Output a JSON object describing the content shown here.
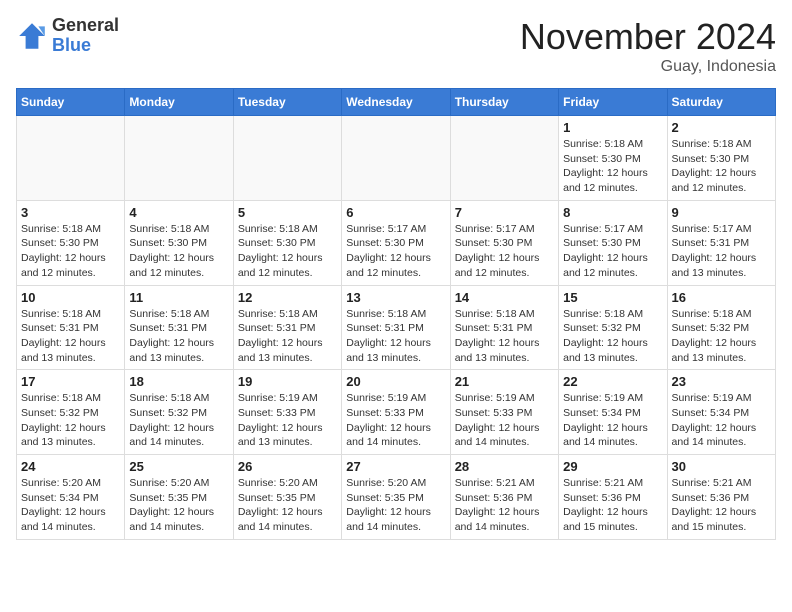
{
  "header": {
    "logo_line1": "General",
    "logo_line2": "Blue",
    "month": "November 2024",
    "location": "Guay, Indonesia"
  },
  "weekdays": [
    "Sunday",
    "Monday",
    "Tuesday",
    "Wednesday",
    "Thursday",
    "Friday",
    "Saturday"
  ],
  "weeks": [
    [
      {
        "day": "",
        "info": ""
      },
      {
        "day": "",
        "info": ""
      },
      {
        "day": "",
        "info": ""
      },
      {
        "day": "",
        "info": ""
      },
      {
        "day": "",
        "info": ""
      },
      {
        "day": "1",
        "info": "Sunrise: 5:18 AM\nSunset: 5:30 PM\nDaylight: 12 hours\nand 12 minutes."
      },
      {
        "day": "2",
        "info": "Sunrise: 5:18 AM\nSunset: 5:30 PM\nDaylight: 12 hours\nand 12 minutes."
      }
    ],
    [
      {
        "day": "3",
        "info": "Sunrise: 5:18 AM\nSunset: 5:30 PM\nDaylight: 12 hours\nand 12 minutes."
      },
      {
        "day": "4",
        "info": "Sunrise: 5:18 AM\nSunset: 5:30 PM\nDaylight: 12 hours\nand 12 minutes."
      },
      {
        "day": "5",
        "info": "Sunrise: 5:18 AM\nSunset: 5:30 PM\nDaylight: 12 hours\nand 12 minutes."
      },
      {
        "day": "6",
        "info": "Sunrise: 5:17 AM\nSunset: 5:30 PM\nDaylight: 12 hours\nand 12 minutes."
      },
      {
        "day": "7",
        "info": "Sunrise: 5:17 AM\nSunset: 5:30 PM\nDaylight: 12 hours\nand 12 minutes."
      },
      {
        "day": "8",
        "info": "Sunrise: 5:17 AM\nSunset: 5:30 PM\nDaylight: 12 hours\nand 12 minutes."
      },
      {
        "day": "9",
        "info": "Sunrise: 5:17 AM\nSunset: 5:31 PM\nDaylight: 12 hours\nand 13 minutes."
      }
    ],
    [
      {
        "day": "10",
        "info": "Sunrise: 5:18 AM\nSunset: 5:31 PM\nDaylight: 12 hours\nand 13 minutes."
      },
      {
        "day": "11",
        "info": "Sunrise: 5:18 AM\nSunset: 5:31 PM\nDaylight: 12 hours\nand 13 minutes."
      },
      {
        "day": "12",
        "info": "Sunrise: 5:18 AM\nSunset: 5:31 PM\nDaylight: 12 hours\nand 13 minutes."
      },
      {
        "day": "13",
        "info": "Sunrise: 5:18 AM\nSunset: 5:31 PM\nDaylight: 12 hours\nand 13 minutes."
      },
      {
        "day": "14",
        "info": "Sunrise: 5:18 AM\nSunset: 5:31 PM\nDaylight: 12 hours\nand 13 minutes."
      },
      {
        "day": "15",
        "info": "Sunrise: 5:18 AM\nSunset: 5:32 PM\nDaylight: 12 hours\nand 13 minutes."
      },
      {
        "day": "16",
        "info": "Sunrise: 5:18 AM\nSunset: 5:32 PM\nDaylight: 12 hours\nand 13 minutes."
      }
    ],
    [
      {
        "day": "17",
        "info": "Sunrise: 5:18 AM\nSunset: 5:32 PM\nDaylight: 12 hours\nand 13 minutes."
      },
      {
        "day": "18",
        "info": "Sunrise: 5:18 AM\nSunset: 5:32 PM\nDaylight: 12 hours\nand 14 minutes."
      },
      {
        "day": "19",
        "info": "Sunrise: 5:19 AM\nSunset: 5:33 PM\nDaylight: 12 hours\nand 13 minutes."
      },
      {
        "day": "20",
        "info": "Sunrise: 5:19 AM\nSunset: 5:33 PM\nDaylight: 12 hours\nand 14 minutes."
      },
      {
        "day": "21",
        "info": "Sunrise: 5:19 AM\nSunset: 5:33 PM\nDaylight: 12 hours\nand 14 minutes."
      },
      {
        "day": "22",
        "info": "Sunrise: 5:19 AM\nSunset: 5:34 PM\nDaylight: 12 hours\nand 14 minutes."
      },
      {
        "day": "23",
        "info": "Sunrise: 5:19 AM\nSunset: 5:34 PM\nDaylight: 12 hours\nand 14 minutes."
      }
    ],
    [
      {
        "day": "24",
        "info": "Sunrise: 5:20 AM\nSunset: 5:34 PM\nDaylight: 12 hours\nand 14 minutes."
      },
      {
        "day": "25",
        "info": "Sunrise: 5:20 AM\nSunset: 5:35 PM\nDaylight: 12 hours\nand 14 minutes."
      },
      {
        "day": "26",
        "info": "Sunrise: 5:20 AM\nSunset: 5:35 PM\nDaylight: 12 hours\nand 14 minutes."
      },
      {
        "day": "27",
        "info": "Sunrise: 5:20 AM\nSunset: 5:35 PM\nDaylight: 12 hours\nand 14 minutes."
      },
      {
        "day": "28",
        "info": "Sunrise: 5:21 AM\nSunset: 5:36 PM\nDaylight: 12 hours\nand 14 minutes."
      },
      {
        "day": "29",
        "info": "Sunrise: 5:21 AM\nSunset: 5:36 PM\nDaylight: 12 hours\nand 15 minutes."
      },
      {
        "day": "30",
        "info": "Sunrise: 5:21 AM\nSunset: 5:36 PM\nDaylight: 12 hours\nand 15 minutes."
      }
    ]
  ]
}
